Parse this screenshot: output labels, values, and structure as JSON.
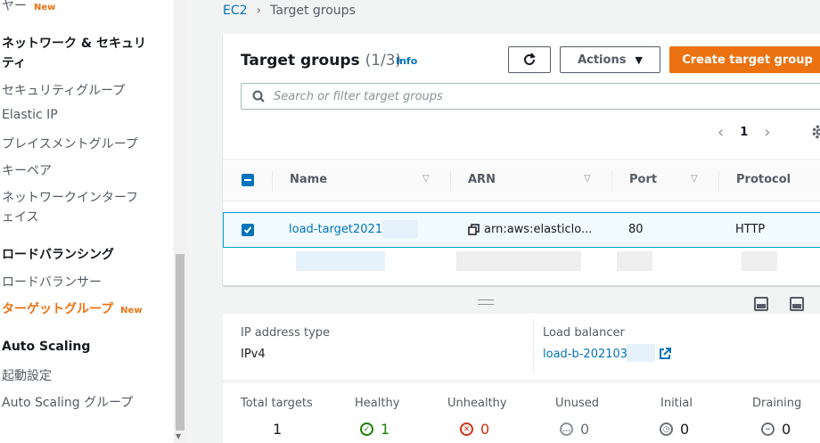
{
  "sidebar": {
    "item_top": "ヤー",
    "item_top_badge": "New",
    "section_network": "ネットワーク & セキュリ",
    "section_network_2": "ティ",
    "items_network": [
      "セキュリティグループ",
      "Elastic IP",
      "プレイスメントグループ",
      "キーペア",
      "ネットワークインターフ"
    ],
    "item_network_cont": "ェイス",
    "section_lb": "ロードバランシング",
    "item_lb": "ロードバランサー",
    "item_tg": "ターゲットグループ",
    "item_tg_badge": "New",
    "section_as": "Auto Scaling",
    "items_as": [
      "起動設定",
      "Auto Scaling グループ"
    ]
  },
  "breadcrumb": {
    "root": "EC2",
    "current": "Target groups"
  },
  "header": {
    "title": "Target groups",
    "count": "(1/3)",
    "info": "Info",
    "actions_label": "Actions",
    "create_label": "Create target group"
  },
  "search": {
    "placeholder": "Search or filter target groups"
  },
  "pagination": {
    "page": "1"
  },
  "table": {
    "columns": [
      "Name",
      "ARN",
      "Port",
      "Protocol"
    ],
    "rows": [
      {
        "name": "load-target2021",
        "arn": "arn:aws:elasticlo...",
        "port": "80",
        "protocol": "HTTP",
        "selected": true
      }
    ]
  },
  "details": {
    "ip_type_label": "IP address type",
    "ip_type_value": "IPv4",
    "lb_label": "Load balancer",
    "lb_value": "load-b-202103"
  },
  "stats": {
    "total": {
      "label": "Total targets",
      "value": "1"
    },
    "healthy": {
      "label": "Healthy",
      "value": "1"
    },
    "unhealthy": {
      "label": "Unhealthy",
      "value": "0"
    },
    "unused": {
      "label": "Unused",
      "value": "0"
    },
    "initial": {
      "label": "Initial",
      "value": "0"
    },
    "draining": {
      "label": "Draining",
      "value": "0"
    }
  },
  "colors": {
    "accent": "#ec7211",
    "link": "#0073bb",
    "healthy": "#1d8102",
    "unhealthy": "#d13212",
    "neutral": "#687078"
  }
}
